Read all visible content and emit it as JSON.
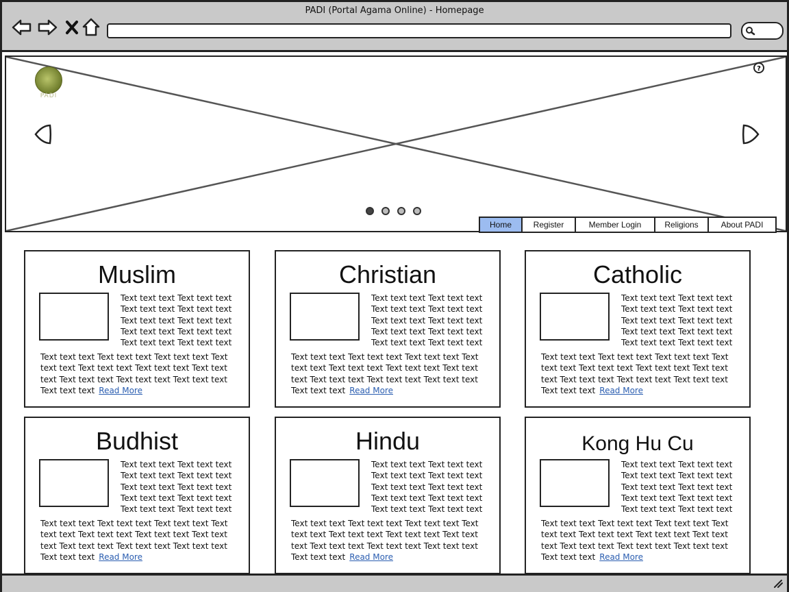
{
  "window": {
    "title": "PADI (Portal Agama Online) - Homepage"
  },
  "toolbar": {
    "back_icon": "back-arrow-icon",
    "forward_icon": "forward-arrow-icon",
    "stop_icon": "close-icon",
    "home_icon": "home-icon",
    "url": ""
  },
  "hero": {
    "logo_text": "PADI",
    "dots": [
      true,
      false,
      false,
      false
    ]
  },
  "menu": {
    "items": [
      "Home",
      "Register",
      "Member Login",
      "Religions",
      "About PADI"
    ],
    "active": "Home"
  },
  "cards": [
    {
      "title": "Muslim",
      "side": "Text text text Text text text Text text text Text text text Text text text Text text text Text text text Text text text Text text text Text text text",
      "body": "Text text text Text text text Text text text Text text text Text text text Text text text Text text text Text text text Text text text Text text text Text text text",
      "link": "Read More"
    },
    {
      "title": "Christian",
      "side": "Text text text Text text text Text text text Text text text Text text text Text text text Text text text Text text text Text text text Text text text",
      "body": "Text text text Text text text Text text text Text text text Text text text Text text text Text text text Text text text Text text text Text text text Text text text",
      "link": "Read More"
    },
    {
      "title": "Catholic",
      "side": "Text text text Text text text Text text text Text text text Text text text Text text text Text text text Text text text Text text text Text text text",
      "body": "Text text text Text text text Text text text Text text text Text text text Text text text Text text text Text text text Text text text Text text text Text text text",
      "link": "Read More"
    },
    {
      "title": "Budhist",
      "side": "Text text text Text text text Text text text Text text text Text text text Text text text Text text text Text text text Text text text Text text text",
      "body": "Text text text Text text text Text text text Text text text Text text text Text text text Text text text Text text text Text text text Text text text Text text text",
      "link": "Read More"
    },
    {
      "title": "Hindu",
      "side": "Text text text Text text text Text text text Text text text Text text text Text text text Text text text Text text text Text text text Text text text",
      "body": "Text text text Text text text Text text text Text text text Text text text Text text text Text text text Text text text Text text text Text text text Text text text",
      "link": "Read More"
    },
    {
      "title": "Kong Hu Cu",
      "side": "Text text text Text text text Text text text Text text text Text text text Text text text Text text text Text text text Text text text Text text text",
      "body": "Text text text Text text text Text text text Text text text Text text text Text text text Text text text Text text text Text text text Text text text Text text text",
      "link": "Read More"
    }
  ]
}
